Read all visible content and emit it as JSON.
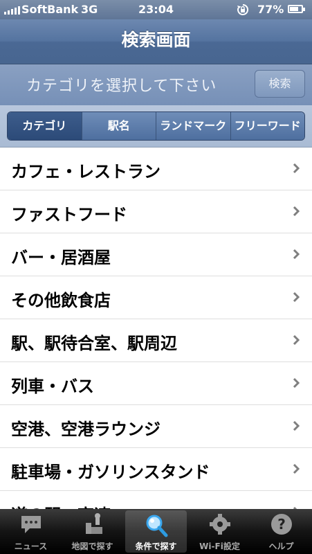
{
  "status_bar": {
    "carrier": "SoftBank",
    "network": "3G",
    "time": "23:04",
    "battery": "77%",
    "battery_level": 0.77
  },
  "nav": {
    "title": "検索画面"
  },
  "search_header": {
    "prompt": "カテゴリを選択して下さい",
    "search_button": "検索"
  },
  "segments": [
    {
      "label": "カテゴリ",
      "selected": true
    },
    {
      "label": "駅名",
      "selected": false
    },
    {
      "label": "ランドマーク",
      "selected": false
    },
    {
      "label": "フリーワード",
      "selected": false
    }
  ],
  "categories": [
    "カフェ・レストラン",
    "ファストフード",
    "バー・居酒屋",
    "その他飲食店",
    "駅、駅待合室、駅周辺",
    "列車・バス",
    "空港、空港ラウンジ",
    "駐車場・ガソリンスタンド",
    "道の駅・高速"
  ],
  "tabs": [
    {
      "label": "ニュース",
      "icon": "speech-bubble-icon",
      "active": false
    },
    {
      "label": "地図で探す",
      "icon": "map-icon",
      "active": false
    },
    {
      "label": "条件で探す",
      "icon": "magnifier-icon",
      "active": true
    },
    {
      "label": "Wi-Fi設定",
      "icon": "gear-icon",
      "active": false
    },
    {
      "label": "ヘルプ",
      "icon": "help-icon",
      "active": false
    }
  ]
}
